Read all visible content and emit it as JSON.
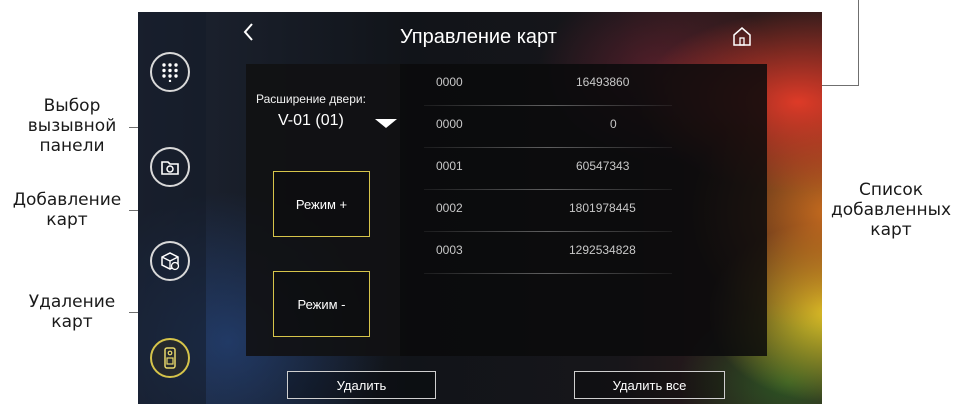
{
  "annotations": {
    "caller_panel": [
      "Выбор",
      "вызывной",
      "панели"
    ],
    "add_cards": [
      "Добавление",
      "карт"
    ],
    "delete_cards": [
      "Удаление",
      "карт"
    ],
    "card_list": [
      "Список",
      "добавленных",
      "карт"
    ]
  },
  "header": {
    "title": "Управление карт",
    "back_icon": "chevron-left",
    "home_icon": "home"
  },
  "sidebar": {
    "icons": [
      "keypad",
      "camera-folder",
      "settings-box",
      "card-reader"
    ],
    "active_index": 3
  },
  "door_expansion": {
    "label": "Расширение двери:",
    "value": "V-01 (01)"
  },
  "modes": {
    "add": "Режим +",
    "remove": "Режим -"
  },
  "cards": [
    {
      "code": "0000",
      "number": "16493860"
    },
    {
      "code": "0000",
      "number": "0"
    },
    {
      "code": "0001",
      "number": "60547343"
    },
    {
      "code": "0002",
      "number": "1801978445"
    },
    {
      "code": "0003",
      "number": "1292534828"
    }
  ],
  "footer": {
    "delete": "Удалить",
    "delete_all": "Удалить все"
  },
  "colors": {
    "accent": "#d6c44a",
    "panel": "#0a0a0c",
    "text": "#ffffff"
  }
}
